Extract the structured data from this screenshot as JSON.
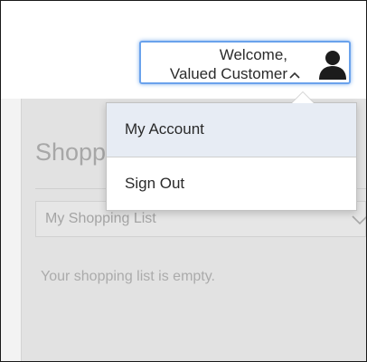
{
  "header": {
    "welcome_line": "Welcome,",
    "customer_name": "Valued Customer",
    "icons": {
      "chevron": "chevron-up-icon",
      "user": "user-avatar-icon"
    },
    "focus_color": "#6aa2ec"
  },
  "account_menu": {
    "items": [
      {
        "label": "My Account",
        "highlighted": true
      },
      {
        "label": "Sign Out",
        "highlighted": false
      }
    ],
    "highlight_color": "#e7ecf4"
  },
  "page": {
    "title": "Shopp",
    "list_select": {
      "selected": "My Shopping List",
      "icon": "chevron-down-icon"
    },
    "empty_message": "Your shopping list is empty."
  }
}
